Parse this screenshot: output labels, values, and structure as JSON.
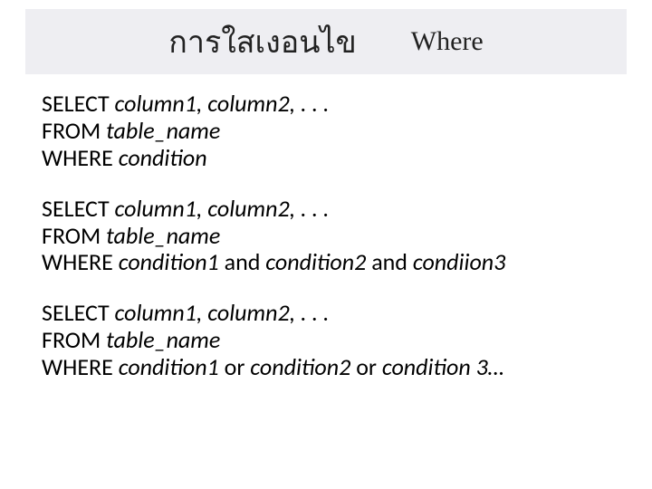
{
  "title": {
    "thai": "การใสเงอนไข",
    "eng": "Where"
  },
  "blocks": [
    {
      "l1a": "SELECT ",
      "l1b": "column1, column2, . . .",
      "l2a": "FROM ",
      "l2b": "table_name",
      "l3a": "WHERE ",
      "l3b": "condition"
    },
    {
      "l1a": "SELECT ",
      "l1b": "column1, column2, . . .",
      "l2a": "FROM ",
      "l2b": "table_name",
      "l3a": "WHERE ",
      "l3b": "condition1 ",
      "l3c": "and ",
      "l3d": "condition2  ",
      "l3e": "and ",
      "l3f": "condiion3"
    },
    {
      "l1a": "SELECT ",
      "l1b": "column1, column2, . . .",
      "l2a": "FROM ",
      "l2b": "table_name",
      "l3a": "WHERE ",
      "l3b": "condition1 ",
      "l3c": "or ",
      "l3d": "condition2  ",
      "l3e": "or ",
      "l3f": "condition 3…"
    }
  ]
}
